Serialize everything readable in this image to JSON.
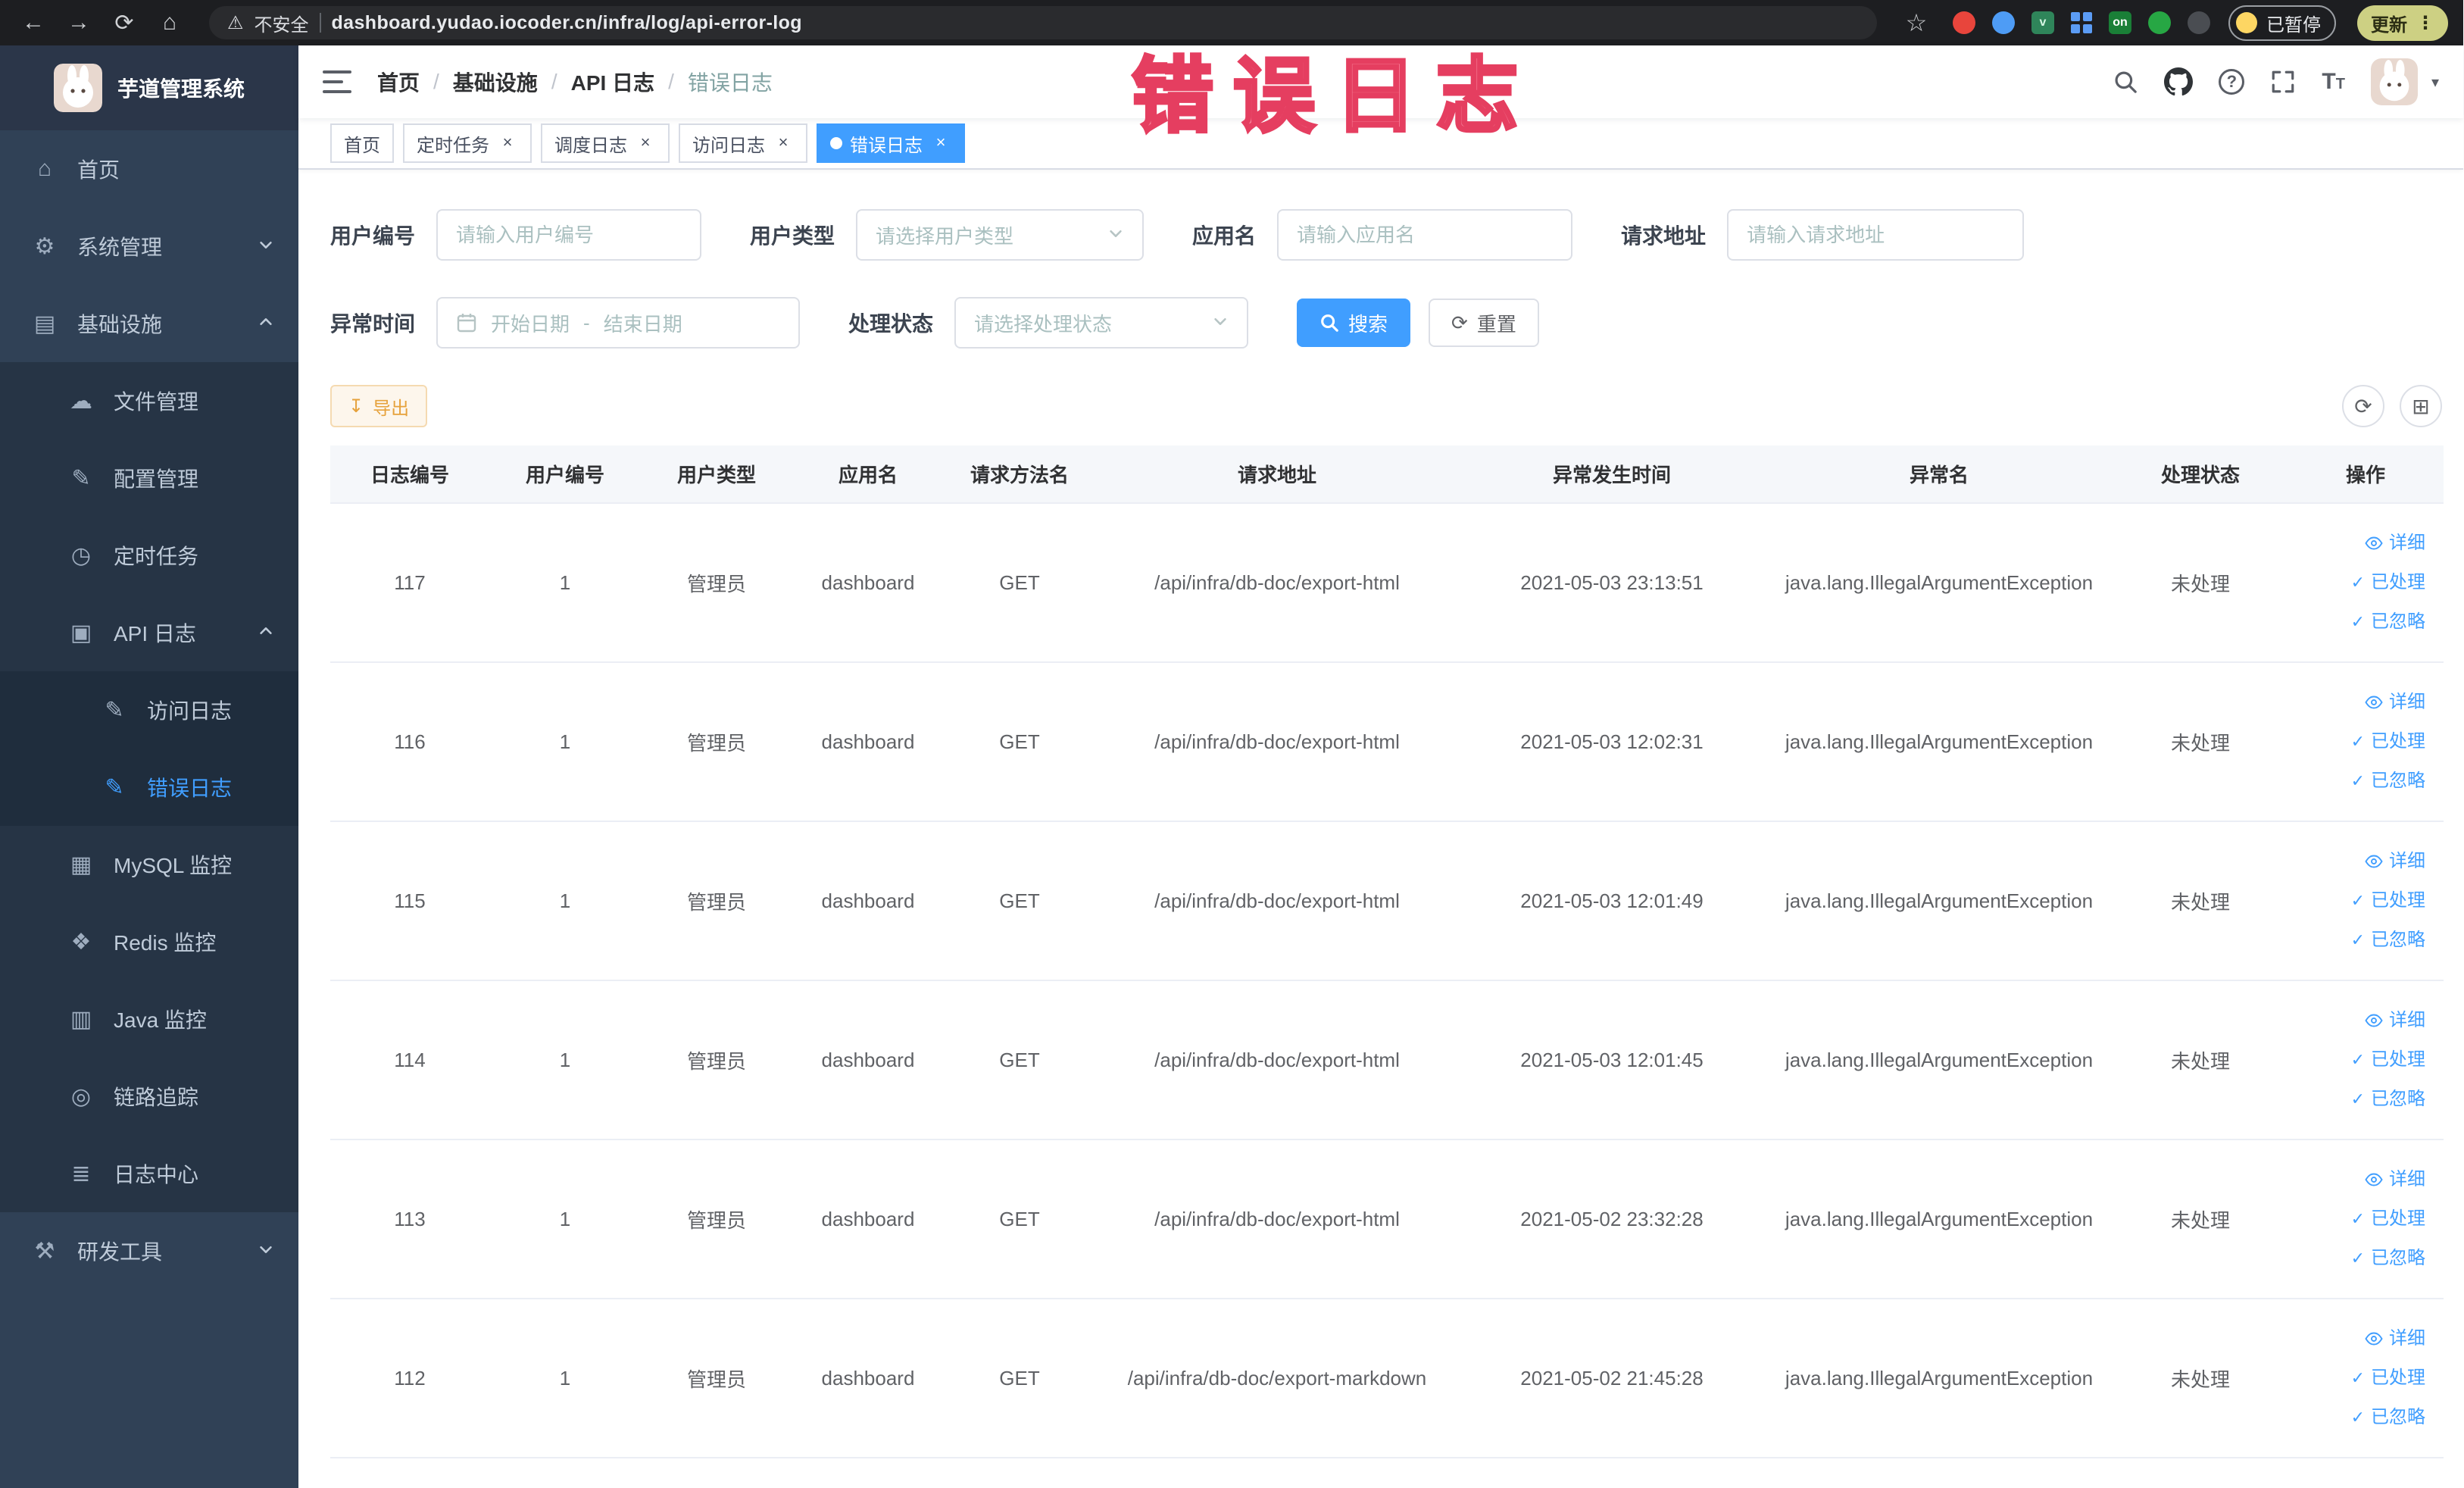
{
  "browser": {
    "security_label": "不安全",
    "url": "dashboard.yudao.iocoder.cn/infra/log/api-error-log",
    "profile_badge": "已暂停",
    "update_button": "更新"
  },
  "annotation": {
    "text": "错误日志"
  },
  "icons": {
    "back": "←",
    "forward": "→",
    "reload": "⟳",
    "home": "⌂",
    "warning": "⚠",
    "star": "☆",
    "menu_dots": "⋮",
    "on_badge": "on",
    "close": "×",
    "question": "?",
    "font": "T",
    "caret": "▾",
    "refresh": "⟳",
    "columns_grid": "⊞",
    "download": "↧",
    "check": "✓"
  },
  "sidebar": {
    "logo_title": "芋道管理系统",
    "items": [
      {
        "label": "首页",
        "icon": "⌂"
      },
      {
        "label": "系统管理",
        "icon": "⚙"
      },
      {
        "label": "基础设施",
        "icon": "▤"
      },
      {
        "label": "文件管理",
        "icon": "☁"
      },
      {
        "label": "配置管理",
        "icon": "✎"
      },
      {
        "label": "定时任务",
        "icon": "◷"
      },
      {
        "label": "API 日志",
        "icon": "▣"
      },
      {
        "label": "访问日志",
        "icon": "✎"
      },
      {
        "label": "错误日志",
        "icon": "✎"
      },
      {
        "label": "MySQL 监控",
        "icon": "▦"
      },
      {
        "label": "Redis 监控",
        "icon": "❖"
      },
      {
        "label": "Java 监控",
        "icon": "▥"
      },
      {
        "label": "链路追踪",
        "icon": "◎"
      },
      {
        "label": "日志中心",
        "icon": "≣"
      },
      {
        "label": "研发工具",
        "icon": "⚒"
      }
    ]
  },
  "header": {
    "breadcrumb": [
      "首页",
      "基础设施",
      "API 日志",
      "错误日志"
    ],
    "separator": "/"
  },
  "tabs": [
    {
      "label": "首页"
    },
    {
      "label": "定时任务"
    },
    {
      "label": "调度日志"
    },
    {
      "label": "访问日志"
    },
    {
      "label": "错误日志"
    }
  ],
  "filters": {
    "user_id": {
      "label": "用户编号",
      "placeholder": "请输入用户编号"
    },
    "user_type": {
      "label": "用户类型",
      "placeholder": "请选择用户类型"
    },
    "app_name": {
      "label": "应用名",
      "placeholder": "请输入应用名"
    },
    "request_url": {
      "label": "请求地址",
      "placeholder": "请输入请求地址"
    },
    "exception_time": {
      "label": "异常时间",
      "start_placeholder": "开始日期",
      "separator": "-",
      "end_placeholder": "结束日期"
    },
    "process_status": {
      "label": "处理状态",
      "placeholder": "请选择处理状态"
    },
    "search_button": "搜索",
    "reset_button": "重置"
  },
  "toolbar": {
    "export_button": "导出"
  },
  "table": {
    "columns": [
      "日志编号",
      "用户编号",
      "用户类型",
      "应用名",
      "请求方法名",
      "请求地址",
      "异常发生时间",
      "异常名",
      "处理状态",
      "操作"
    ],
    "action_labels": {
      "detail": "详细",
      "processed": "已处理",
      "ignored": "已忽略"
    },
    "rows": [
      {
        "log_id": "117",
        "user_id": "1",
        "user_type": "管理员",
        "app_name": "dashboard",
        "method": "GET",
        "url": "/api/infra/db-doc/export-html",
        "time": "2021-05-03 23:13:51",
        "exception": "java.lang.IllegalArgumentException",
        "status": "未处理"
      },
      {
        "log_id": "116",
        "user_id": "1",
        "user_type": "管理员",
        "app_name": "dashboard",
        "method": "GET",
        "url": "/api/infra/db-doc/export-html",
        "time": "2021-05-03 12:02:31",
        "exception": "java.lang.IllegalArgumentException",
        "status": "未处理"
      },
      {
        "log_id": "115",
        "user_id": "1",
        "user_type": "管理员",
        "app_name": "dashboard",
        "method": "GET",
        "url": "/api/infra/db-doc/export-html",
        "time": "2021-05-03 12:01:49",
        "exception": "java.lang.IllegalArgumentException",
        "status": "未处理"
      },
      {
        "log_id": "114",
        "user_id": "1",
        "user_type": "管理员",
        "app_name": "dashboard",
        "method": "GET",
        "url": "/api/infra/db-doc/export-html",
        "time": "2021-05-03 12:01:45",
        "exception": "java.lang.IllegalArgumentException",
        "status": "未处理"
      },
      {
        "log_id": "113",
        "user_id": "1",
        "user_type": "管理员",
        "app_name": "dashboard",
        "method": "GET",
        "url": "/api/infra/db-doc/export-html",
        "time": "2021-05-02 23:32:28",
        "exception": "java.lang.IllegalArgumentException",
        "status": "未处理"
      },
      {
        "log_id": "112",
        "user_id": "1",
        "user_type": "管理员",
        "app_name": "dashboard",
        "method": "GET",
        "url": "/api/infra/db-doc/export-markdown",
        "time": "2021-05-02 21:45:28",
        "exception": "java.lang.IllegalArgumentException",
        "status": "未处理"
      }
    ]
  }
}
